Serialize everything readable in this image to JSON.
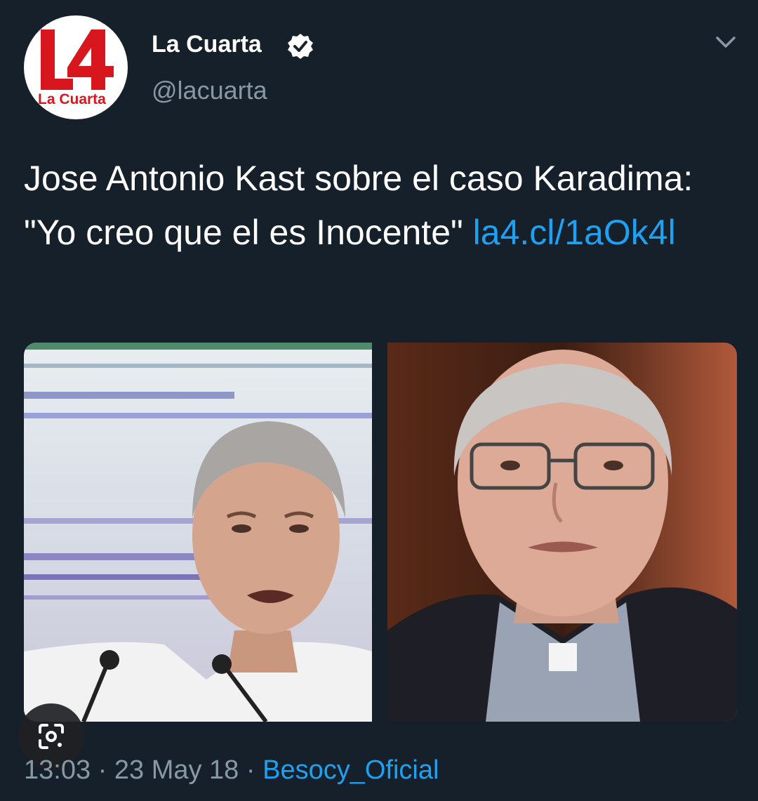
{
  "author": {
    "logo_text": "L4",
    "logo_caption": "La Cuarta",
    "name": "La Cuarta",
    "handle": "@lacuarta",
    "verified": true
  },
  "tweet": {
    "text": "Jose Antonio Kast sobre el caso Karadima: \"Yo creo que el es Inocente\"",
    "link": "la4.cl/1aOk4l"
  },
  "media": {
    "count": 2,
    "left_photo": "man-with-microphones",
    "right_photo": "elderly-priest-with-glasses"
  },
  "footer": {
    "time": "13:03",
    "separator": "·",
    "date": "23 May 18",
    "source": "Besocy_Oficial"
  },
  "icons": {
    "verified": "verified-badge-icon",
    "menu": "chevron-down-icon",
    "lens": "lens-search-icon"
  },
  "colors": {
    "background": "#15202b",
    "text": "#ffffff",
    "muted": "#8899a6",
    "link": "#1da1f2",
    "brand": "#d8161e"
  }
}
